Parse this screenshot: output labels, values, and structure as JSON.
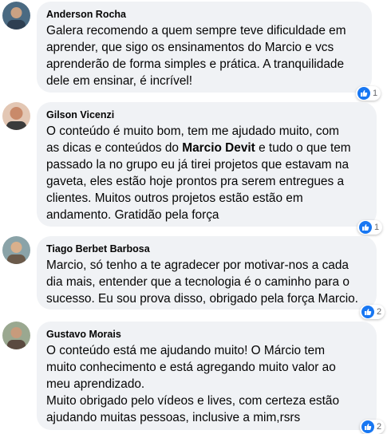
{
  "comments": [
    {
      "author": "Anderson Rocha",
      "text": "Galera recomendo a quem sempre teve dificuldade em\naprender, que sigo os ensinamentos do Marcio e vcs\naprenderão de forma simples e prática. A tranquilidade\ndele em ensinar, é incrível!",
      "reaction_count": "1",
      "avatar_colors": [
        "#4a6a82",
        "#2e3f52"
      ]
    },
    {
      "author": "Gilson Vicenzi",
      "text_before": "O conteúdo é muito bom, tem me ajudado muito, com\nas dicas e conteúdos do ",
      "text_bold": "Marcio Devit",
      "text_after": " e tudo o que tem\npassado la no grupo eu já tirei projetos que estavam na\ngaveta, eles estão hoje prontos pra serem entregues a\nclientes. Muitos outros projetos estão estão em\nandamento. Gratidão pela força",
      "reaction_count": "1",
      "avatar_colors": [
        "#c98a6a",
        "#3b3b3b"
      ]
    },
    {
      "author": "Tiago Berbet Barbosa",
      "text": "Marcio, só tenho a te agradecer por motivar-nos a cada\ndia mais, entender que a tecnologia é o caminho para o\nsucesso. Eu sou prova disso, obrigado pela força Marcio.",
      "reaction_count": "2",
      "avatar_colors": [
        "#8aa3a8",
        "#6b5a4a"
      ]
    },
    {
      "author": "Gustavo Morais",
      "text": "O conteúdo está me ajudando muito! O Márcio tem\nmuito conhecimento e está agregando muito valor ao\nmeu aprendizado.\nMuito obrigado pelo vídeos e lives, com certeza estão\najudando muitas pessoas, inclusive a mim,rsrs",
      "reaction_count": "2",
      "avatar_colors": [
        "#9aa890",
        "#5a4a40"
      ]
    }
  ],
  "colors": {
    "bubble": "#f0f2f5",
    "like": "#1877f2",
    "text": "#050505",
    "muted": "#65676b"
  },
  "icons": {
    "like": "thumbs-up-icon",
    "avatar": "avatar-photo"
  }
}
